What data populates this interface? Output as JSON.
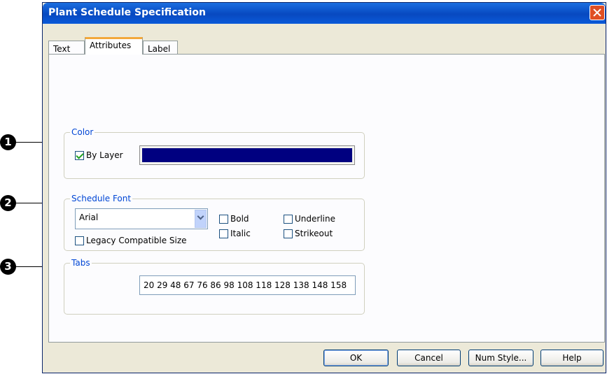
{
  "window": {
    "title": "Plant Schedule Specification"
  },
  "tabs": [
    {
      "label": "Text"
    },
    {
      "label": "Attributes"
    },
    {
      "label": "Label"
    }
  ],
  "color_group": {
    "legend": "Color",
    "by_layer": {
      "label": "By Layer",
      "checked": true
    },
    "swatch_color": "#000080"
  },
  "font_group": {
    "legend": "Schedule Font",
    "font_select": {
      "value": "Arial"
    },
    "bold": {
      "label": "Bold",
      "checked": false
    },
    "italic": {
      "label": "Italic",
      "checked": false
    },
    "underline": {
      "label": "Underline",
      "checked": false
    },
    "strikeout": {
      "label": "Strikeout",
      "checked": false
    },
    "legacy": {
      "label": "Legacy Compatible Size",
      "checked": false
    }
  },
  "tabs_group": {
    "legend": "Tabs",
    "value": "20 29 48 67 76 86 98 108 118 128 138 148 158"
  },
  "buttons": {
    "ok": "OK",
    "cancel": "Cancel",
    "num_style": "Num Style...",
    "help": "Help"
  },
  "callouts": [
    "1",
    "2",
    "3"
  ],
  "colors": {
    "title_bar": "#0a4fc6",
    "legend": "#0046d5",
    "tab_highlight": "#f3a83a"
  }
}
